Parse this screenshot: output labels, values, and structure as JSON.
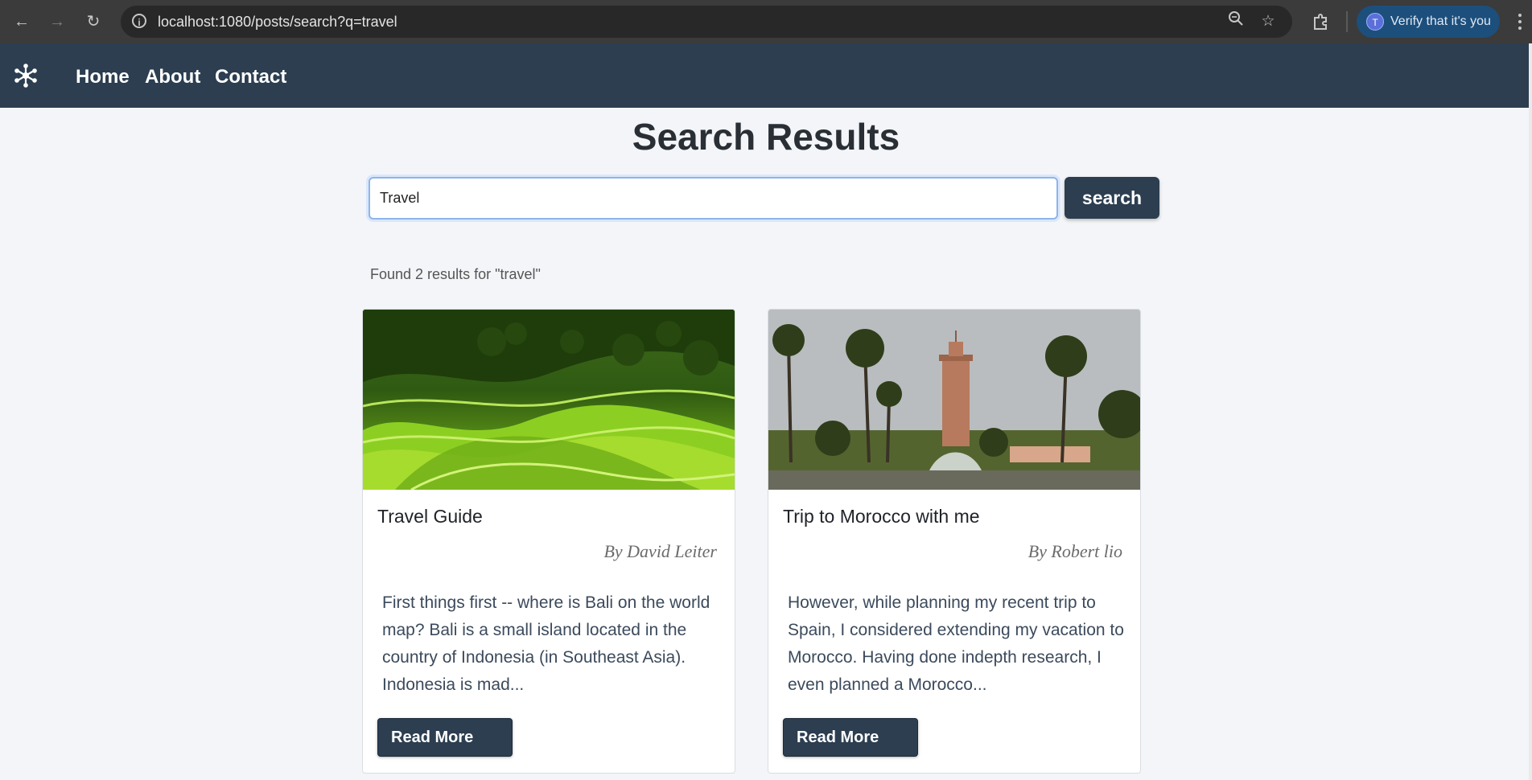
{
  "browser": {
    "url": "localhost:1080/posts/search?q=travel",
    "profile_chip_label": "Verify that it's you",
    "profile_initial": "T"
  },
  "nav": {
    "links": [
      "Home",
      "About",
      "Contact"
    ]
  },
  "page": {
    "title": "Search Results"
  },
  "search": {
    "value": "Travel",
    "button_label": "search"
  },
  "results": {
    "summary": "Found 2 results for \"travel\"",
    "cards": [
      {
        "title": "Travel Guide",
        "author": "By David Leiter",
        "excerpt": "First things first -- where is Bali on the world map? Bali is a small island located in the country of Indonesia (in Southeast Asia). Indonesia is mad...",
        "button_label": "Read More"
      },
      {
        "title": "Trip to Morocco with me",
        "author": "By Robert lio",
        "excerpt": "However, while planning my recent trip to Spain, I considered extending my vacation to Morocco. Having done indepth research, I even planned a Morocco...",
        "button_label": "Read More"
      }
    ]
  },
  "colors": {
    "nav_bg": "#2c3e50",
    "page_bg": "#f3f5f8",
    "button_bg": "#2c3e50"
  }
}
